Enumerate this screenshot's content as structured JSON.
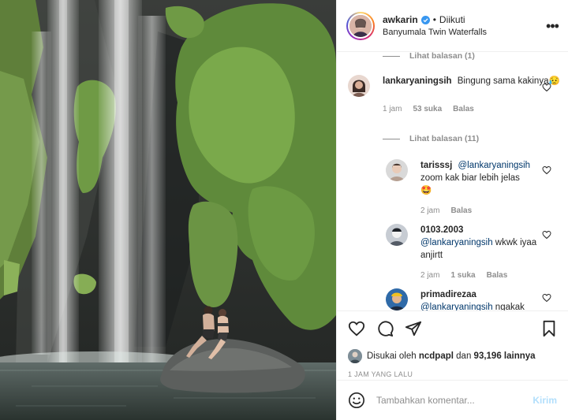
{
  "header": {
    "username": "awkarin",
    "dot": "•",
    "follow_status": "Diikuti",
    "location": "Banyumala Twin Waterfalls"
  },
  "comments": {
    "view_replies_top": "Lihat balasan (1)",
    "main_comment": {
      "user": "lankaryaningsih",
      "text": "Bingung sama kakinya",
      "emoji": "😥",
      "time": "1 jam",
      "likes": "53 suka",
      "reply": "Balas"
    },
    "view_replies_main": "Lihat balasan (11)",
    "replies": [
      {
        "user": "tarisssj",
        "mention": "@lankaryaningsih",
        "text": "zoom kak biar lebih jelas",
        "emoji": "🤩",
        "time": "2 jam",
        "likes": "",
        "reply": "Balas"
      },
      {
        "user": "0103.2003",
        "mention": "@lankaryaningsih",
        "text": "wkwk iyaa anjirtt",
        "emoji": "",
        "time": "2 jam",
        "likes": "1 suka",
        "reply": "Balas"
      },
      {
        "user": "primadirezaa",
        "mention": "@lankaryaningsih",
        "text": "ngakak",
        "emoji": "",
        "time": "",
        "likes": "",
        "reply": ""
      }
    ]
  },
  "likes": {
    "prefix": "Disukai oleh",
    "liker": "ncdpapl",
    "and": "dan",
    "count": "93,196 lainnya"
  },
  "timestamp": "1 JAM YANG LALU",
  "add_comment": {
    "placeholder": "Tambahkan komentar...",
    "post_label": "Kirim"
  },
  "colors": {
    "mention": "#00376b",
    "muted": "#8e8e8e",
    "post_disabled": "#b2dffc",
    "verified": "#3897f0"
  }
}
